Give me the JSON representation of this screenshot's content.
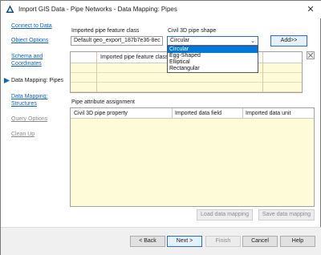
{
  "window": {
    "title": "Import GIS Data - Pipe Networks - Data Mapping: Pipes",
    "close_glyph": "✕"
  },
  "nav": {
    "items": [
      {
        "label": "Connect to Data",
        "state": "link"
      },
      {
        "label": "Object Options",
        "state": "link"
      },
      {
        "label": "Schema and Coordinates",
        "state": "link"
      },
      {
        "label": "Data Mapping: Pipes",
        "state": "current"
      },
      {
        "label": "Data Mapping: Structures",
        "state": "link"
      },
      {
        "label": "Query Options",
        "state": "disabled"
      },
      {
        "label": "Clean Up",
        "state": "disabled"
      }
    ]
  },
  "mapping": {
    "feature_class_label": "Imported pipe feature class",
    "feature_class_value": "Default geo_export_187b7e36-8ec",
    "pipe_shape_label": "Civil 3D pipe shape",
    "pipe_shape_value": "Circular",
    "add_button": "Add>>",
    "shape_options": [
      "Circular",
      "Egg-Shaped",
      "Elliptical",
      "Rectangular"
    ],
    "selected_option_index": 0
  },
  "mapping_table": {
    "columns": [
      "Imported pipe feature class"
    ]
  },
  "attributes": {
    "section_label": "Pipe attribute assignment",
    "columns": [
      "Civil 3D pipe property",
      "Imported data field",
      "Imported data unit"
    ],
    "load_button": "Load data mapping",
    "save_button": "Save data mapping"
  },
  "footer": {
    "back": "< Back",
    "next": "Next >",
    "finish": "Finish",
    "cancel": "Cancel",
    "help": "Help"
  },
  "colors": {
    "link": "#0b62c4",
    "selection": "#0078d7",
    "grid_fill": "#fdfbd8",
    "accent_border": "#2b6bd6"
  },
  "icons": {
    "app": "autodesk-triangle-icon",
    "current_step": "arrow-right-icon",
    "table_options": "grid-options-icon"
  }
}
